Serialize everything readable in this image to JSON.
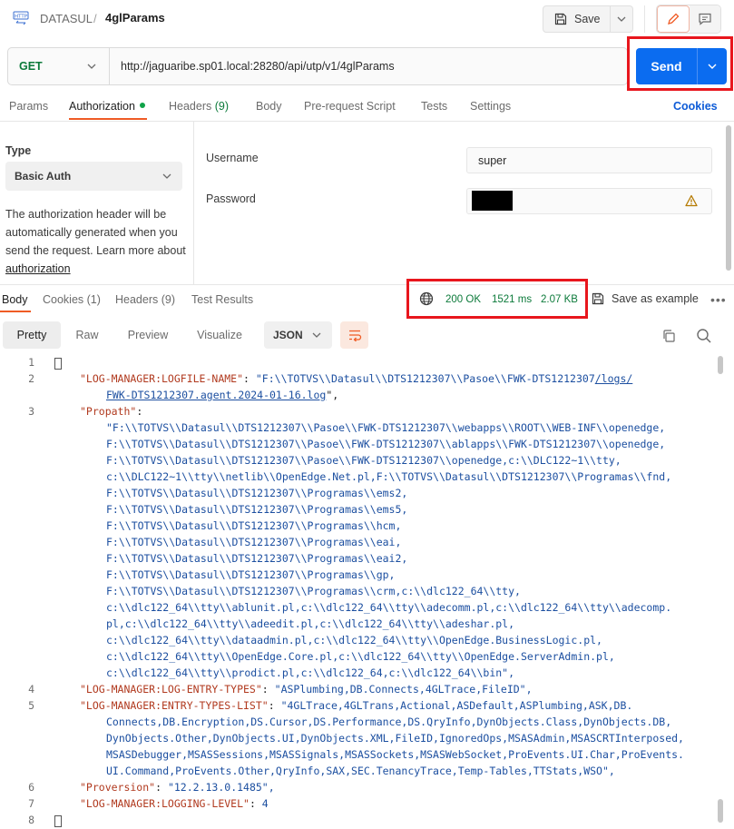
{
  "header": {
    "workspace": "DATASUL",
    "separator": "/",
    "request_name": "4glParams",
    "save_label": "Save"
  },
  "request": {
    "method": "GET",
    "url": "http://jaguaribe.sp01.local:28280/api/utp/v1/4glParams",
    "send_label": "Send"
  },
  "request_tabs": {
    "params": "Params",
    "authorization": "Authorization",
    "headers": "Headers",
    "headers_count": "(9)",
    "body": "Body",
    "pre_request": "Pre-request Script",
    "tests": "Tests",
    "settings": "Settings",
    "cookies": "Cookies"
  },
  "auth": {
    "type_label": "Type",
    "type_value": "Basic Auth",
    "desc_part1": "The authorization header will be automatically generated when you send the request. Learn more about ",
    "desc_link": "authorization",
    "username_label": "Username",
    "username_value": "super",
    "password_label": "Password"
  },
  "response_tabs": {
    "body": "Body",
    "cookies": "Cookies (1)",
    "headers": "Headers (9)",
    "test_results": "Test Results"
  },
  "status": {
    "code": "200 OK",
    "time": "1521 ms",
    "size": "2.07 KB",
    "save_example": "Save as example"
  },
  "view": {
    "pretty": "Pretty",
    "raw": "Raw",
    "preview": "Preview",
    "visualize": "Visualize",
    "format": "JSON"
  },
  "code": {
    "line_numbers": [
      "1",
      "2",
      "3",
      "4",
      "5",
      "6",
      "7",
      "8"
    ],
    "l2_key": "\"LOG-MANAGER:LOGFILE-NAME\"",
    "l2_val_a": "\"F:\\\\TOTVS\\\\Datasul\\\\DTS1212307\\\\Pasoe\\\\FWK-DTS1212307",
    "l2_val_link": "/logs/",
    "l2_val_b_link": "FWK-DTS1212307.agent.2024-01-16.log",
    "l2_val_b_end": "\",",
    "l3_key": "\"Propath\"",
    "propath": [
      "\"F:\\\\TOTVS\\\\Datasul\\\\DTS1212307\\\\Pasoe\\\\FWK-DTS1212307\\\\webapps\\\\ROOT\\\\WEB-INF\\\\openedge,",
      "F:\\\\TOTVS\\\\Datasul\\\\DTS1212307\\\\Pasoe\\\\FWK-DTS1212307\\\\ablapps\\\\FWK-DTS1212307\\\\openedge,",
      "F:\\\\TOTVS\\\\Datasul\\\\DTS1212307\\\\Pasoe\\\\FWK-DTS1212307\\\\openedge,c:\\\\DLC122~1\\\\tty,",
      "c:\\\\DLC122~1\\\\tty\\\\netlib\\\\OpenEdge.Net.pl,F:\\\\TOTVS\\\\Datasul\\\\DTS1212307\\\\Programas\\\\fnd,",
      "F:\\\\TOTVS\\\\Datasul\\\\DTS1212307\\\\Programas\\\\ems2,",
      "F:\\\\TOTVS\\\\Datasul\\\\DTS1212307\\\\Programas\\\\ems5,",
      "F:\\\\TOTVS\\\\Datasul\\\\DTS1212307\\\\Programas\\\\hcm,",
      "F:\\\\TOTVS\\\\Datasul\\\\DTS1212307\\\\Programas\\\\eai,",
      "F:\\\\TOTVS\\\\Datasul\\\\DTS1212307\\\\Programas\\\\eai2,",
      "F:\\\\TOTVS\\\\Datasul\\\\DTS1212307\\\\Programas\\\\gp,",
      "F:\\\\TOTVS\\\\Datasul\\\\DTS1212307\\\\Programas\\\\crm,c:\\\\dlc122_64\\\\tty,",
      "c:\\\\dlc122_64\\\\tty\\\\ablunit.pl,c:\\\\dlc122_64\\\\tty\\\\adecomm.pl,c:\\\\dlc122_64\\\\tty\\\\adecomp.",
      "pl,c:\\\\dlc122_64\\\\tty\\\\adeedit.pl,c:\\\\dlc122_64\\\\tty\\\\adeshar.pl,",
      "c:\\\\dlc122_64\\\\tty\\\\dataadmin.pl,c:\\\\dlc122_64\\\\tty\\\\OpenEdge.BusinessLogic.pl,",
      "c:\\\\dlc122_64\\\\tty\\\\OpenEdge.Core.pl,c:\\\\dlc122_64\\\\tty\\\\OpenEdge.ServerAdmin.pl,",
      "c:\\\\dlc122_64\\\\tty\\\\prodict.pl,c:\\\\dlc122_64,c:\\\\dlc122_64\\\\bin\","
    ],
    "l4_key": "\"LOG-MANAGER:LOG-ENTRY-TYPES\"",
    "l4_val": "\"ASPlumbing,DB.Connects,4GLTrace,FileID\",",
    "l5_key": "\"LOG-MANAGER:ENTRY-TYPES-LIST\"",
    "l5_first": "\"4GLTrace,4GLTrans,Actional,ASDefault,ASPlumbing,ASK,DB.",
    "l5_cont": [
      "Connects,DB.Encryption,DS.Cursor,DS.Performance,DS.QryInfo,DynObjects.Class,DynObjects.DB,",
      "DynObjects.Other,DynObjects.UI,DynObjects.XML,FileID,IgnoredOps,MSASAdmin,MSASCRTInterposed,",
      "MSASDebugger,MSASSessions,MSASSignals,MSASSockets,MSASWebSocket,ProEvents.UI.Char,ProEvents.",
      "UI.Command,ProEvents.Other,QryInfo,SAX,SEC.TenancyTrace,Temp-Tables,TTStats,WSO\","
    ],
    "l6_key": "\"Proversion\"",
    "l6_val": "\"12.2.13.0.1485\",",
    "l7_key": "\"LOG-MANAGER:LOGGING-LEVEL\"",
    "l7_val": "4",
    "colon": ": "
  },
  "colors": {
    "accent": "#ef5b25",
    "send": "#0b6cf0",
    "status_ok": "#0c7a3a",
    "highlight_box": "#e8161d"
  }
}
